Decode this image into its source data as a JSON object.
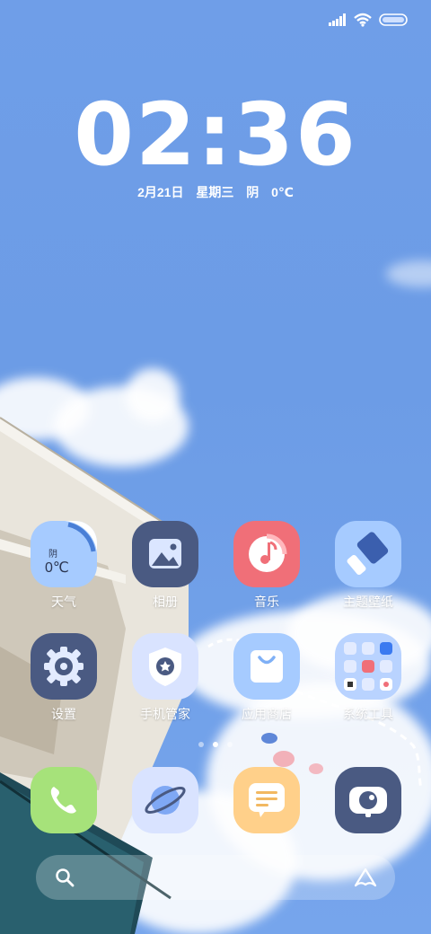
{
  "status_bar": {
    "icons": [
      "signal-icon",
      "wifi-icon",
      "battery-icon"
    ]
  },
  "clock": {
    "time": "02:36"
  },
  "date_line": {
    "date": "2月21日",
    "weekday": "星期三",
    "weather": "阴",
    "temperature": "0℃"
  },
  "weather_widget": {
    "condition": "阴",
    "temperature": "0℃"
  },
  "apps_row1": [
    {
      "label": "天气",
      "icon": "weather-icon"
    },
    {
      "label": "相册",
      "icon": "gallery-icon"
    },
    {
      "label": "音乐",
      "icon": "music-icon"
    },
    {
      "label": "主题壁纸",
      "icon": "themes-icon"
    }
  ],
  "apps_row2": [
    {
      "label": "设置",
      "icon": "settings-icon"
    },
    {
      "label": "手机管家",
      "icon": "security-icon"
    },
    {
      "label": "应用商店",
      "icon": "app-store-icon"
    },
    {
      "label": "系统工具",
      "icon": "folder-icon"
    }
  ],
  "dock": [
    {
      "icon": "phone-icon"
    },
    {
      "icon": "browser-icon"
    },
    {
      "icon": "messages-icon"
    },
    {
      "icon": "camera-icon"
    }
  ],
  "page_indicator": {
    "pages": 3,
    "active": 2
  },
  "search_bar": {
    "left_icon": "search-icon",
    "right_icon": "assistant-icon"
  },
  "colors": {
    "sky": "#6f9ee8",
    "gallery": "#4a5a82",
    "music": "#f06f78",
    "themes": "#a6cbff",
    "settings": "#4a5a82",
    "security": "#d9e3ff",
    "app_store": "#a6cbff",
    "phone": "#a6e27a",
    "browser": "#d9e3ff",
    "messages": "#ffd08a",
    "camera": "#4a5a82"
  }
}
